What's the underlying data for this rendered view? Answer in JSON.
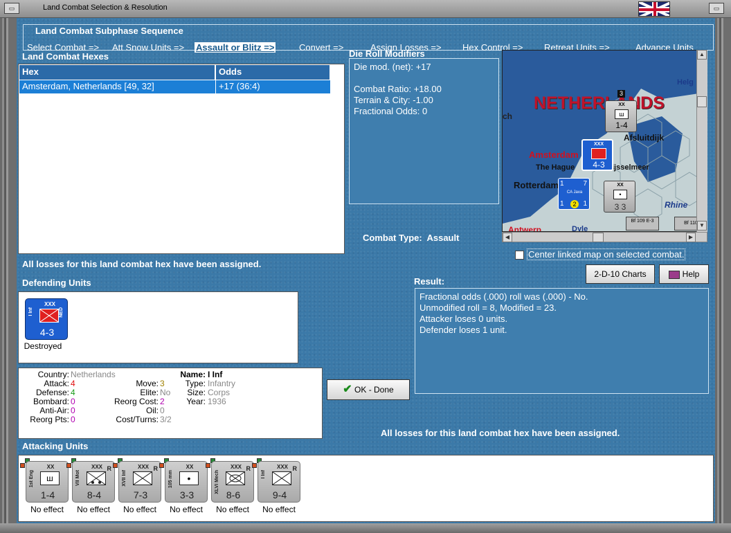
{
  "window": {
    "title": "Land Combat Selection & Resolution"
  },
  "sequence": {
    "title": "Land Combat Subphase Sequence",
    "items": [
      "Select Combat =>",
      "Att Snow Units =>",
      "Assault or Blitz =>",
      "Convert =>",
      "Assign Losses =>",
      "Hex Control =>",
      "Retreat Units =>",
      "Advance Units"
    ],
    "active_index": 2
  },
  "hexes": {
    "title": "Land Combat Hexes",
    "columns": [
      "Hex",
      "Odds"
    ],
    "rows": [
      {
        "hex": "Amsterdam, Netherlands [49, 32]",
        "odds": "+17 (36:4)"
      }
    ]
  },
  "modifiers": {
    "title": "Die Roll Modifiers",
    "net": "Die mod. (net): +17",
    "ratio": "Combat Ratio: +18.00",
    "terrain": "Terrain & City: -1.00",
    "fractional": "Fractional Odds: 0"
  },
  "map": {
    "country_label": "NETHERLANDS",
    "cities": [
      "Amsterdam",
      "The Hague",
      "Rotterdam",
      "Antwerp"
    ],
    "places": [
      "Helg",
      "Zuiderzee",
      "Afsluitdijk",
      "ch",
      "ijsselmeer",
      "Rhine",
      "Dyle"
    ],
    "counters": [
      {
        "size": "XX",
        "str": "1-4",
        "num": "3"
      },
      {
        "size": "XXX",
        "str": "4-3",
        "name": "I Inf",
        "side": "NED"
      },
      {
        "size": "",
        "str": "1 7 / 1 1",
        "name": "CA Java"
      },
      {
        "size": "XX",
        "str": "3 3",
        "num": "3"
      },
      {
        "size": "",
        "str": "Bf 109 E-3"
      },
      {
        "size": "",
        "str": "Bf 110",
        "num": "4"
      }
    ],
    "center_label": "Center linked map on selected combat."
  },
  "combat_type": {
    "label": "Combat Type:",
    "value": "Assault"
  },
  "status": {
    "losses_assigned": "All losses for this land combat hex have been assigned.",
    "losses_assigned_2": "All losses for this land combat hex have been assigned."
  },
  "buttons": {
    "charts": "2-D-10 Charts",
    "help": "Help",
    "ok": "OK - Done"
  },
  "result": {
    "title": "Result:",
    "lines": [
      "Fractional odds (.000) roll was (.000)  - No.",
      "Unmodified roll = 8, Modified = 23.",
      "Attacker loses 0 units.",
      "Defender loses 1 unit."
    ]
  },
  "defenders": {
    "title": "Defending Units",
    "units": [
      {
        "name": "I Inf",
        "size": "XXX",
        "side": "NED",
        "strength": "4-3",
        "effect": "Destroyed"
      }
    ]
  },
  "unit_info": {
    "country_label": "Country:",
    "country": "Netherlands",
    "attack_label": "Attack:",
    "attack": "4",
    "defense_label": "Defense:",
    "defense": "4",
    "bombard_label": "Bombard:",
    "bombard": "0",
    "antiair_label": "Anti-Air:",
    "antiair": "0",
    "reorgpts_label": "Reorg Pts:",
    "reorgpts": "0",
    "move_label": "Move:",
    "move": "3",
    "elite_label": "Elite:",
    "elite": "No",
    "reorgcost_label": "Reorg Cost:",
    "reorgcost": "2",
    "oil_label": "Oil:",
    "oil": "0",
    "costturns_label": "Cost/Turns:",
    "costturns": "3/2",
    "name_label": "Name:",
    "name": "I Inf",
    "type_label": "Type:",
    "type": "Infantry",
    "size_label": "Size:",
    "size": "Corps",
    "year_label": "Year:",
    "year": "1936"
  },
  "colors": {
    "attack": "#e01010",
    "defense": "#1a9a1a",
    "bombard": "#b000b0",
    "antiair": "#b000b0",
    "reorgpts": "#b000b0",
    "move": "#a08000",
    "reorgcost": "#b000b0"
  },
  "attackers": {
    "title": "Attacking Units",
    "units": [
      {
        "name": "1st Eng",
        "size": "XX",
        "strength": "1-4",
        "effect": "No effect",
        "icon": "engineer-icon",
        "reserve": ""
      },
      {
        "name": "VII Mot",
        "size": "XXX",
        "strength": "8-4",
        "effect": "No effect",
        "icon": "motorized-infantry-icon",
        "reserve": "R"
      },
      {
        "name": "XVII Inf",
        "size": "XXX",
        "strength": "7-3",
        "effect": "No effect",
        "icon": "infantry-icon",
        "reserve": "R"
      },
      {
        "name": "105 mm",
        "size": "XX",
        "strength": "3-3",
        "effect": "No effect",
        "icon": "artillery-icon",
        "reserve": ""
      },
      {
        "name": "XLVI Mech",
        "size": "XXX",
        "strength": "8-6",
        "effect": "No effect",
        "icon": "mechanized-icon",
        "reserve": "R"
      },
      {
        "name": "I Inf",
        "size": "XXX",
        "strength": "9-4",
        "effect": "No effect",
        "icon": "infantry-icon",
        "reserve": "R"
      }
    ]
  }
}
